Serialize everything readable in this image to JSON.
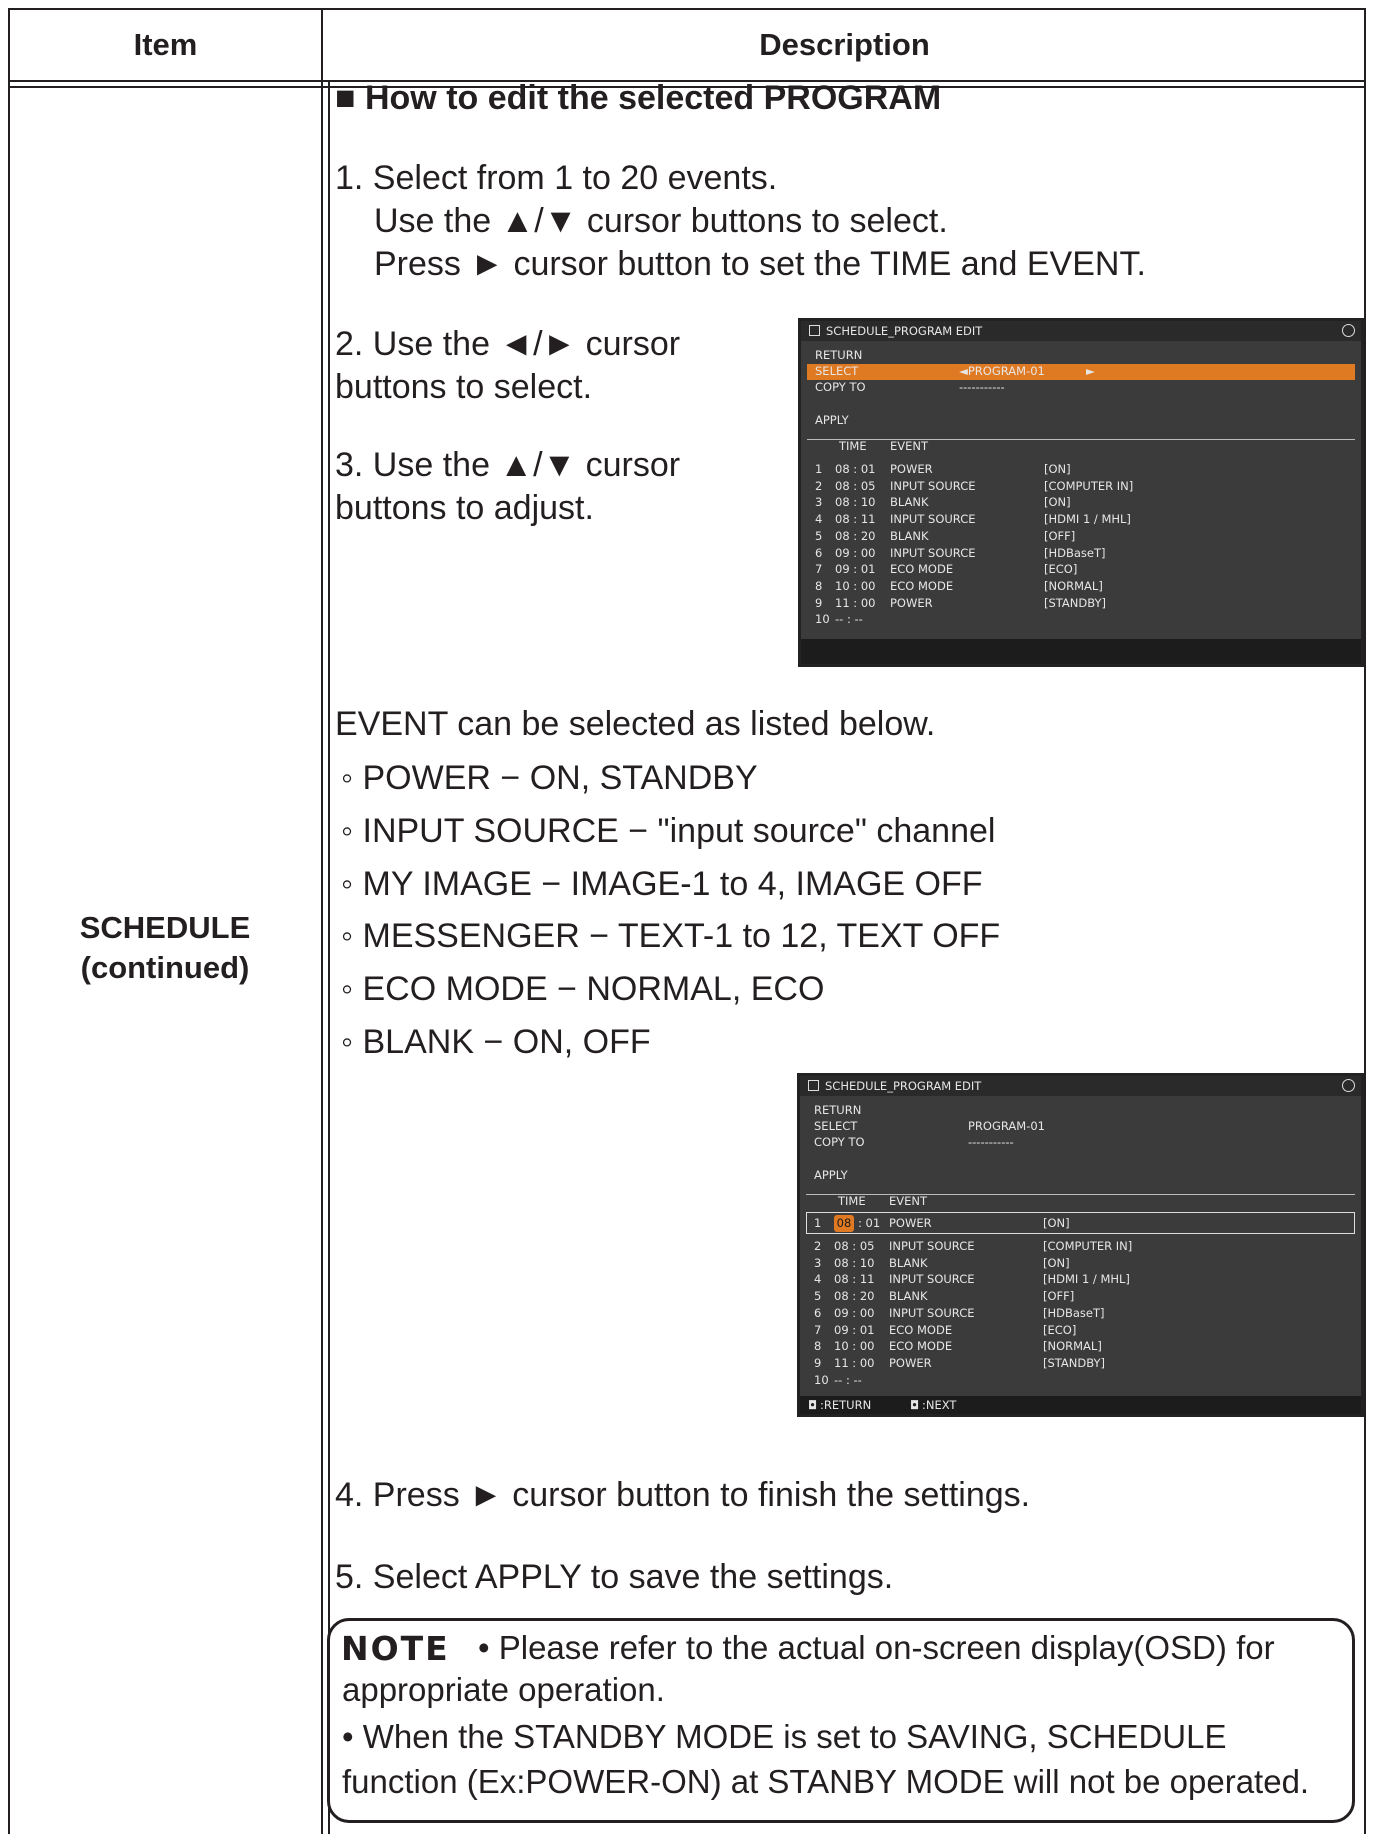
{
  "header": {
    "item": "Item",
    "description": "Description"
  },
  "item_name": [
    "SCHEDULE",
    "(continued)"
  ],
  "section_title": "■ How to edit the selected PROGRAM",
  "step1": [
    "1. Select from 1 to 20 events.",
    "Use the ▲/▼ cursor buttons to select.",
    "Press ► cursor button to set the TIME and EVENT."
  ],
  "step2": [
    "2. Use the ◄/► cursor",
    "buttons to select."
  ],
  "step3": [
    "3. Use the ▲/▼ cursor",
    "buttons to adjust."
  ],
  "osd1": {
    "title": "SCHEDULE_PROGRAM EDIT",
    "menu": {
      "return": "RETURN",
      "select": "SELECT",
      "select_value": "◄PROGRAM-01",
      "select_arrow": "►",
      "copy_to": "COPY TO",
      "copy_value": "-----------",
      "apply": "APPLY"
    },
    "cols": {
      "time": "TIME",
      "event": "EVENT"
    },
    "events": [
      [
        "1",
        "08 : 01",
        "POWER",
        "[ON]"
      ],
      [
        "2",
        "08 : 05",
        "INPUT SOURCE",
        "[COMPUTER IN]"
      ],
      [
        "3",
        "08 : 10",
        "BLANK",
        "[ON]"
      ],
      [
        "4",
        "08 : 11",
        "INPUT SOURCE",
        "[HDMI 1 / MHL]"
      ],
      [
        "5",
        "08 : 20",
        "BLANK",
        "[OFF]"
      ],
      [
        "6",
        "09 : 00",
        "INPUT SOURCE",
        "[HDBaseT]"
      ],
      [
        "7",
        "09 : 01",
        "ECO MODE",
        "[ECO]"
      ],
      [
        "8",
        "10 : 00",
        "ECO MODE",
        "[NORMAL]"
      ],
      [
        "9",
        "11 : 00",
        "POWER",
        "[STANDBY]"
      ],
      [
        "10",
        "-- : --",
        "",
        ""
      ]
    ]
  },
  "event_intro": "EVENT can be selected as listed below.",
  "event_list": [
    "◦ POWER − ON, STANDBY",
    "◦ INPUT SOURCE − \"input source\" channel",
    "◦ MY IMAGE − IMAGE-1 to 4, IMAGE OFF",
    "◦ MESSENGER − TEXT-1 to 12, TEXT OFF",
    "◦ ECO MODE − NORMAL, ECO",
    "◦ BLANK − ON, OFF"
  ],
  "osd2": {
    "title": "SCHEDULE_PROGRAM EDIT",
    "menu": {
      "return": "RETURN",
      "select": "SELECT",
      "select_value": "PROGRAM-01",
      "copy_to": "COPY TO",
      "copy_value": "-----------",
      "apply": "APPLY"
    },
    "cols": {
      "time": "TIME",
      "event": "EVENT"
    },
    "first_row": {
      "num": "1",
      "hour": "08",
      "minute": ": 01",
      "event": "POWER",
      "value": "[ON]"
    },
    "events": [
      [
        "2",
        "08 : 05",
        "INPUT SOURCE",
        "[COMPUTER IN]"
      ],
      [
        "3",
        "08 : 10",
        "BLANK",
        "[ON]"
      ],
      [
        "4",
        "08 : 11",
        "INPUT SOURCE",
        "[HDMI 1 / MHL]"
      ],
      [
        "5",
        "08 : 20",
        "BLANK",
        "[OFF]"
      ],
      [
        "6",
        "09 : 00",
        "INPUT SOURCE",
        "[HDBaseT]"
      ],
      [
        "7",
        "09 : 01",
        "ECO MODE",
        "[ECO]"
      ],
      [
        "8",
        "10 : 00",
        "ECO MODE",
        "[NORMAL]"
      ],
      [
        "9",
        "11 : 00",
        "POWER",
        "[STANDBY]"
      ],
      [
        "10",
        "-- : --",
        "",
        ""
      ]
    ],
    "footer": {
      "return": ":RETURN",
      "next": ":NEXT"
    }
  },
  "step4": "4. Press ► cursor button to finish the settings.",
  "step5": "5. Select APPLY to save the settings.",
  "note": {
    "label": "NOTE",
    "lines": [
      "• Please refer to the actual on-screen display(OSD) for",
      "appropriate operation.",
      "• When the STANDBY MODE is set to SAVING, SCHEDULE",
      "function (Ex:POWER-ON) at STANBY MODE will not be operated."
    ]
  }
}
